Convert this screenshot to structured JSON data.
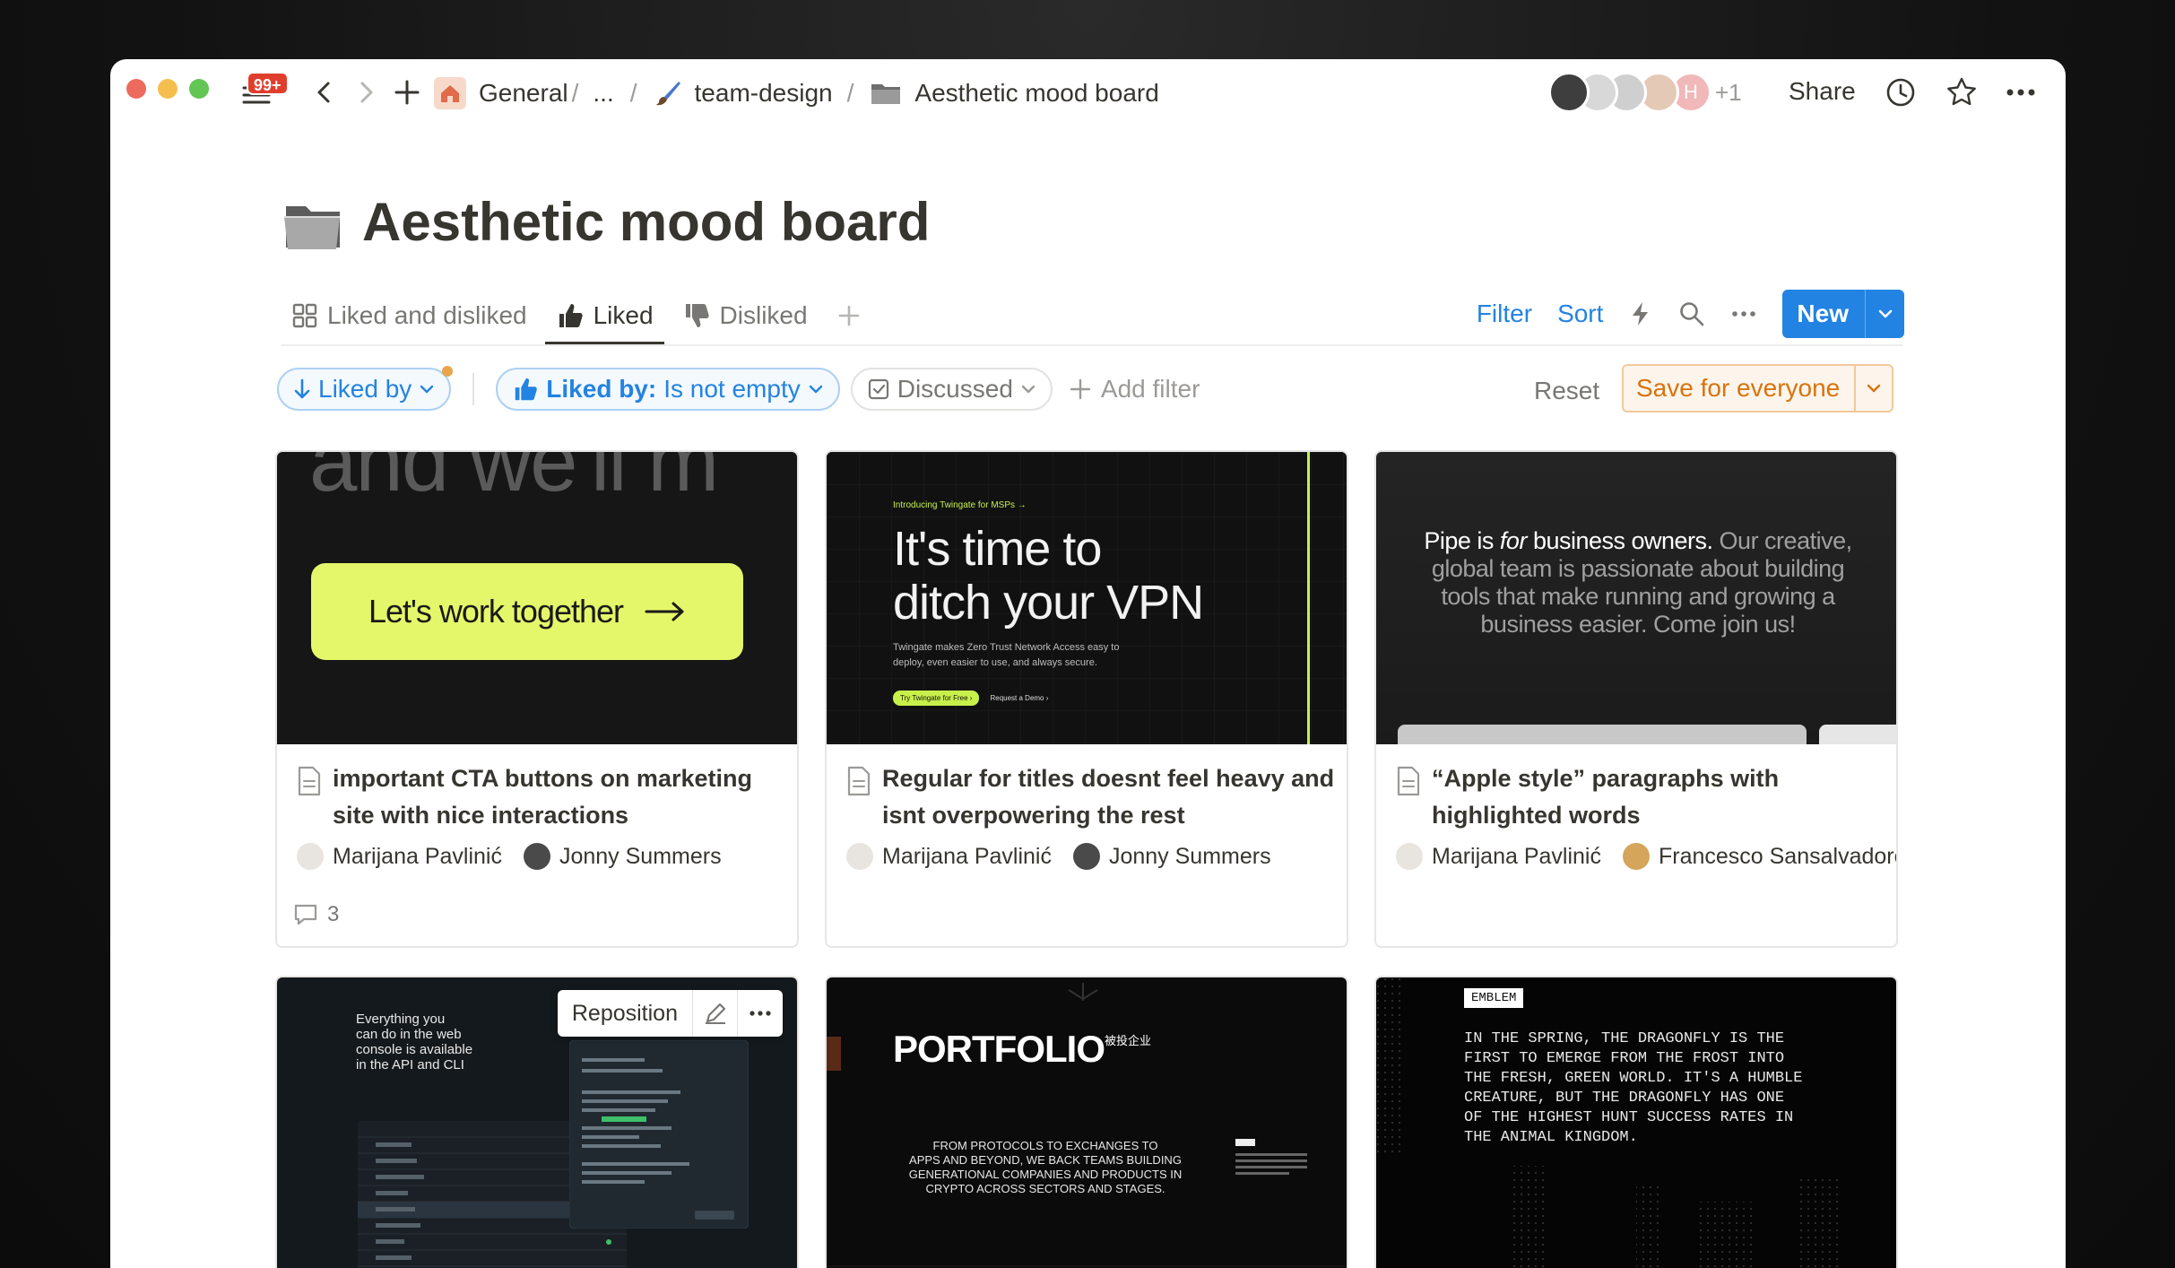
{
  "topbar": {
    "badge": "99+",
    "breadcrumb": {
      "general": "General",
      "ellipsis": "...",
      "team": "team-design",
      "page": "Aesthetic mood board"
    },
    "avatar_h": "H",
    "extra_count": "+1",
    "share": "Share"
  },
  "page": {
    "title": "Aesthetic mood board"
  },
  "tabs": [
    {
      "label": "Liked and disliked"
    },
    {
      "label": "Liked"
    },
    {
      "label": "Disliked"
    }
  ],
  "actions": {
    "filter": "Filter",
    "sort": "Sort",
    "new": "New"
  },
  "filters": {
    "sort_pill": "Liked by",
    "liked_prefix": "Liked by:",
    "liked_cond": "Is not empty",
    "discussed": "Discussed",
    "add_filter": "Add filter",
    "reset": "Reset",
    "save": "Save for everyone"
  },
  "cards": [
    {
      "title": "important CTA buttons on marketing site with nice interactions",
      "people": [
        "Marijana Pavlinić",
        "Jonny Summers"
      ],
      "comments": "3",
      "cover": {
        "top_text": "and we'll m",
        "cta": "Let's work together"
      }
    },
    {
      "title": "Regular for titles doesnt feel heavy and isnt overpowering the rest",
      "people": [
        "Marijana Pavlinić",
        "Jonny Summers"
      ],
      "cover": {
        "eyebrow": "Introducing Twingate for MSPs →",
        "headline1": "It's time to",
        "headline2": "ditch your VPN",
        "sub1": "Twingate makes Zero Trust Network Access easy to",
        "sub2": "deploy, even easier to use, and always secure.",
        "btn1": "Try Twingate for Free ›",
        "btn2": "Request a Demo ›"
      }
    },
    {
      "title": "“Apple style” paragraphs with highlighted words",
      "people": [
        "Marijana Pavlinić",
        "Francesco Sansalvadore"
      ],
      "cover": {
        "l1a": "Pipe is ",
        "l1b": "for",
        "l1c": " business owners.",
        "l1d": " Our creative,",
        "l2": "global team is passionate about building",
        "l3": "tools that make running and growing a",
        "l4": "business easier. Come join us!"
      }
    },
    {
      "reposition": "Reposition",
      "cover": {
        "l1": "Everything you",
        "l2": "can do in the web",
        "l3": "console is available",
        "l4": "in the API and CLI"
      }
    },
    {
      "cover": {
        "title": "PORTFOLIO",
        "super": "被投企业",
        "l1": "FROM PROTOCOLS TO EXCHANGES TO",
        "l2": "APPS AND BEYOND, WE BACK TEAMS BUILDING",
        "l3": "GENERATIONAL COMPANIES AND PRODUCTS IN",
        "l4": "CRYPTO ACROSS SECTORS AND STAGES."
      }
    },
    {
      "cover": {
        "tag": "EMBLEM",
        "l1": "IN THE SPRING, THE DRAGONFLY IS THE",
        "l2": "FIRST TO EMERGE FROM THE FROST INTO",
        "l3": "THE FRESH, GREEN WORLD. IT'S A HUMBLE",
        "l4": "CREATURE, BUT THE DRAGONFLY HAS ONE",
        "l5": "OF THE HIGHEST HUNT SUCCESS RATES IN",
        "l6": "THE ANIMAL KINGDOM."
      }
    }
  ],
  "colors": {
    "accent": "#2383e2",
    "save": "#d9730d",
    "cta": "#e4f76a",
    "twingate": "#c8f04a"
  }
}
